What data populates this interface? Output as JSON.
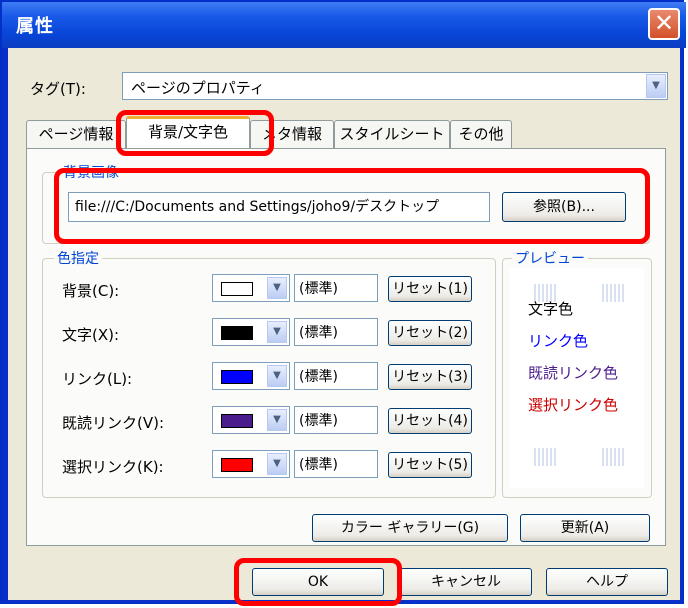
{
  "window": {
    "title": "属性",
    "close_glyph": "✕"
  },
  "tag": {
    "label": "タグ(T):",
    "value": "ページのプロパティ"
  },
  "tabs": [
    {
      "label": "ページ情報"
    },
    {
      "label": "背景/文字色"
    },
    {
      "label": "メタ情報"
    },
    {
      "label": "スタイルシート"
    },
    {
      "label": "その他"
    }
  ],
  "bg_image": {
    "group_title": "背景画像",
    "path": "file:///C:/Documents and Settings/joho9/デスクトップ",
    "browse_label": "参照(B)..."
  },
  "colors": {
    "group_title": "色指定",
    "rows": [
      {
        "label": "背景(C):",
        "color": "#ffffff",
        "value": "(標準)",
        "reset": "リセット(1)"
      },
      {
        "label": "文字(X):",
        "color": "#000000",
        "value": "(標準)",
        "reset": "リセット(2)"
      },
      {
        "label": "リンク(L):",
        "color": "#0000ff",
        "value": "(標準)",
        "reset": "リセット(3)"
      },
      {
        "label": "既読リンク(V):",
        "color": "#4b1c8c",
        "value": "(標準)",
        "reset": "リセット(4)"
      },
      {
        "label": "選択リンク(K):",
        "color": "#ff0000",
        "value": "(標準)",
        "reset": "リセット(5)"
      }
    ]
  },
  "preview": {
    "group_title": "プレビュー",
    "text": "文字色",
    "link": "リンク色",
    "visited": "既読リンク色",
    "selected": "選択リンク色",
    "text_color": "#000000",
    "link_color": "#0000ff",
    "visited_color": "#4b1c8c",
    "selected_color": "#cc0000"
  },
  "buttons": {
    "gallery": "カラー ギャラリー(G)",
    "refresh": "更新(A)",
    "ok": "OK",
    "cancel": "キャンセル",
    "help": "ヘルプ"
  }
}
